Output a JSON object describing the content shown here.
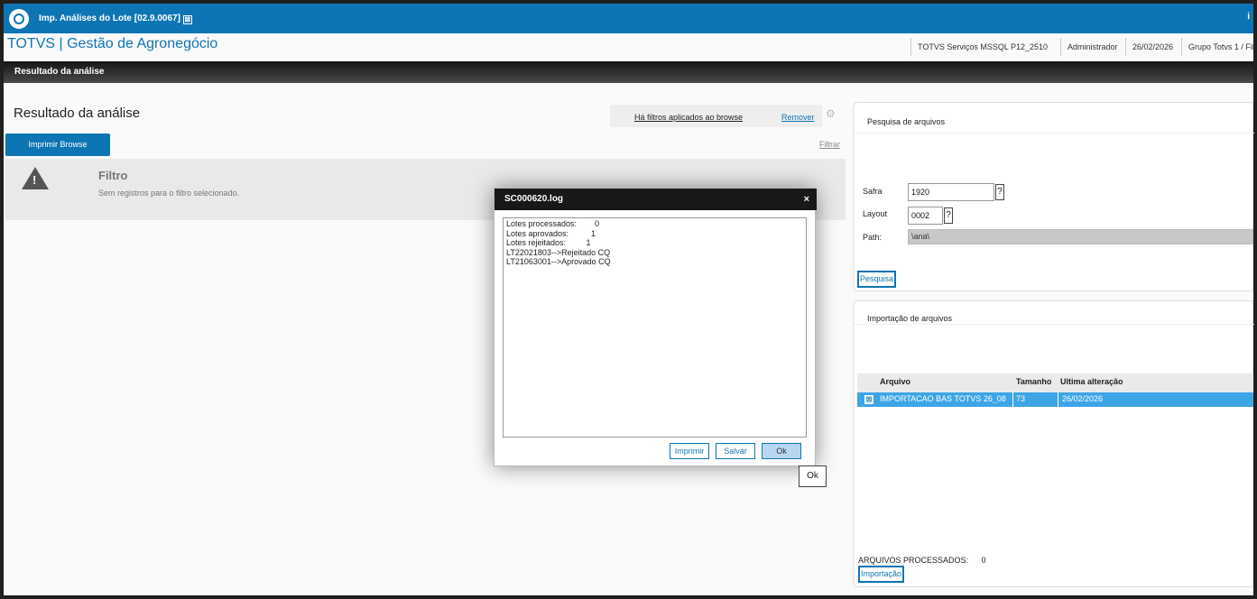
{
  "window": {
    "tab_title": "Imp. Análises do Lote [02.9.0067]",
    "tab_close_glyph": "⊠",
    "corner_label": "i"
  },
  "header": {
    "brand": "TOTVS | Gestão de Agronegócio",
    "info": [
      "TOTVS Serviços MSSQL P12_2510",
      "Administrador",
      "26/02/2026",
      "Grupo Totvs 1 / Fili"
    ]
  },
  "section_bar": {
    "title": "Resultado da análise"
  },
  "main": {
    "title": "Resultado da análise",
    "print_button": "Imprimir Browse",
    "filter_notice": "Há filtros aplicados ao browse",
    "remove_link": "Remover",
    "filter_link": "Filtrar",
    "message_title": "Filtro",
    "message_text": "Sem registros para o filtro selecionado.",
    "warning_glyph": "!"
  },
  "search_panel": {
    "title": "Pesquisa de arquivos",
    "safra_label": "Safra",
    "safra_value": "1920",
    "layout_label": "Layout",
    "layout_value": "0002",
    "path_label": "Path:",
    "path_value": "\\ana\\",
    "help_glyph": "?",
    "search_button": "Pesquisa"
  },
  "import_panel": {
    "title": "Importação de arquivos",
    "columns": [
      "Arquivo",
      "Tamanho",
      "Ultima alteração"
    ],
    "rows": [
      {
        "file": "IMPORTACAO BAS TOTVS 26_08",
        "size": "73",
        "modified": "26/02/2026"
      }
    ],
    "row_marker_glyph": "⊠",
    "processed_label": "ARQUIVOS PROCESSADOS:",
    "processed_count": "0",
    "import_button": "Importação"
  },
  "dialog": {
    "title": "SC000620.log",
    "close_glyph": "×",
    "log_text": "Lotes processados:        0\nLotes aprovados:          1\nLotes rejeitados:         1\nLT22021803-->Rejeitado CQ\nLT21063001-->Aprovado CQ",
    "buttons": {
      "print": "Imprimir",
      "save": "Salvar",
      "ok": "Ok"
    }
  },
  "tooltip": {
    "ok": "Ok"
  },
  "colors": {
    "accent": "#0e75b4",
    "selection": "#3da5e6"
  }
}
